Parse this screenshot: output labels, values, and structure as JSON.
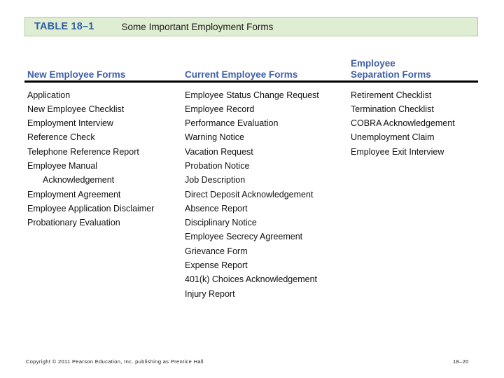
{
  "banner": {
    "table_label": "TABLE 18–1",
    "title": "Some Important Employment Forms",
    "background_color": "#dfeed2",
    "border_color": "#a9cf9a",
    "label_color": "#2f5fa8"
  },
  "table": {
    "heading_color": "#3f5fa8",
    "rule_color": "#000000",
    "columns": [
      {
        "header": "New Employee Forms",
        "items": [
          {
            "text": "Application"
          },
          {
            "text": "New Employee Checklist"
          },
          {
            "text": "Employment Interview"
          },
          {
            "text": "Reference Check"
          },
          {
            "text": "Telephone Reference Report"
          },
          {
            "text": "Employee Manual",
            "continuation": "Acknowledgement"
          },
          {
            "text": "Employment Agreement"
          },
          {
            "text": "Employee Application Disclaimer"
          },
          {
            "text": "Probationary Evaluation"
          }
        ]
      },
      {
        "header": "Current Employee Forms",
        "items": [
          {
            "text": "Employee Status Change Request"
          },
          {
            "text": "Employee Record"
          },
          {
            "text": "Performance Evaluation"
          },
          {
            "text": "Warning Notice"
          },
          {
            "text": "Vacation Request"
          },
          {
            "text": "Probation Notice"
          },
          {
            "text": "Job Description"
          },
          {
            "text": "Direct Deposit Acknowledgement"
          },
          {
            "text": "Absence Report"
          },
          {
            "text": "Disciplinary Notice"
          },
          {
            "text": "Employee Secrecy Agreement"
          },
          {
            "text": "Grievance Form"
          },
          {
            "text": "Expense Report"
          },
          {
            "text": "401(k) Choices Acknowledgement"
          },
          {
            "text": "Injury Report"
          }
        ]
      },
      {
        "header": "Employee\nSeparation Forms",
        "items": [
          {
            "text": "Retirement Checklist"
          },
          {
            "text": "Termination Checklist"
          },
          {
            "text": "COBRA Acknowledgement"
          },
          {
            "text": "Unemployment Claim"
          },
          {
            "text": "Employee Exit Interview"
          }
        ]
      }
    ]
  },
  "footer": {
    "copyright": "Copyright © 2011 Pearson Education, Inc. publishing as Prentice Hall",
    "page_number": "18–20"
  }
}
